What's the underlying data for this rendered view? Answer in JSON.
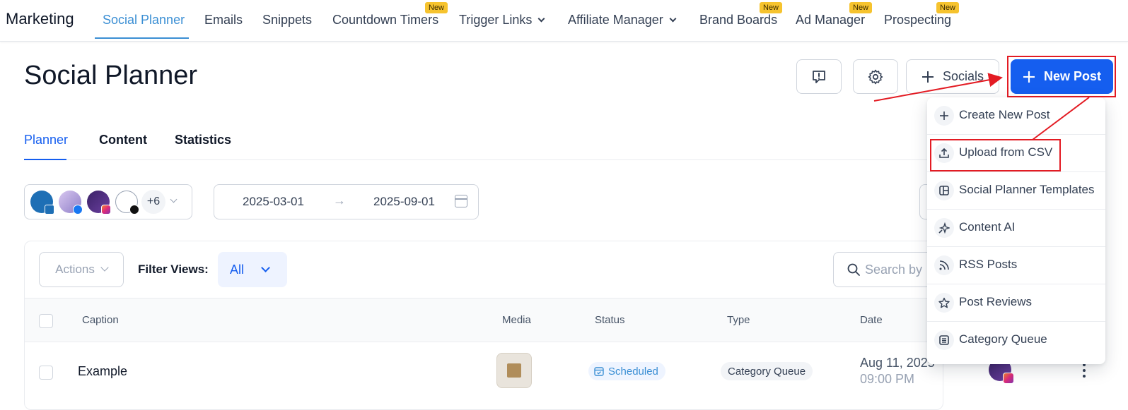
{
  "nav": {
    "brand": "Marketing",
    "items": [
      {
        "label": "Social Planner"
      },
      {
        "label": "Emails"
      },
      {
        "label": "Snippets"
      },
      {
        "label": "Countdown Timers",
        "badge": "New"
      },
      {
        "label": "Trigger Links"
      },
      {
        "label": "Affiliate Manager"
      },
      {
        "label": "Brand Boards",
        "badge": "New"
      },
      {
        "label": "Ad Manager",
        "badge": "New"
      },
      {
        "label": "Prospecting",
        "badge": "New"
      }
    ]
  },
  "header": {
    "title": "Social Planner",
    "feedback_icon": "feedback-icon",
    "settings_icon": "gear-icon",
    "socials_label": "Socials",
    "new_post_label": "New Post"
  },
  "tabs": [
    {
      "label": "Planner"
    },
    {
      "label": "Content"
    },
    {
      "label": "Statistics"
    }
  ],
  "accounts": {
    "more_count": "+6"
  },
  "date_range": {
    "start": "2025-03-01",
    "end": "2025-09-01"
  },
  "toolbar": {
    "actions_label": "Actions",
    "filter_label": "Filter Views:",
    "filter_value": "All",
    "search_placeholder": "Search by"
  },
  "table": {
    "columns": [
      "Caption",
      "Media",
      "Status",
      "Type",
      "Date"
    ],
    "rows": [
      {
        "caption": "Example",
        "status": "Scheduled",
        "type": "Category Queue",
        "date": "Aug 11, 2025",
        "time": "09:00 PM"
      }
    ]
  },
  "dropdown": {
    "items": [
      {
        "label": "Create New Post",
        "icon": "plus-icon"
      },
      {
        "label": "Upload from CSV",
        "icon": "upload-icon"
      },
      {
        "label": "Social Planner Templates",
        "icon": "template-icon"
      },
      {
        "label": "Content AI",
        "icon": "sparkle-icon"
      },
      {
        "label": "RSS Posts",
        "icon": "rss-icon"
      },
      {
        "label": "Post Reviews",
        "icon": "star-icon"
      },
      {
        "label": "Category Queue",
        "icon": "list-icon"
      }
    ]
  },
  "colors": {
    "primary": "#155eef",
    "nav_active": "#3b8fd4",
    "annotation": "#e31b23",
    "new_badge": "#f6c32e"
  }
}
